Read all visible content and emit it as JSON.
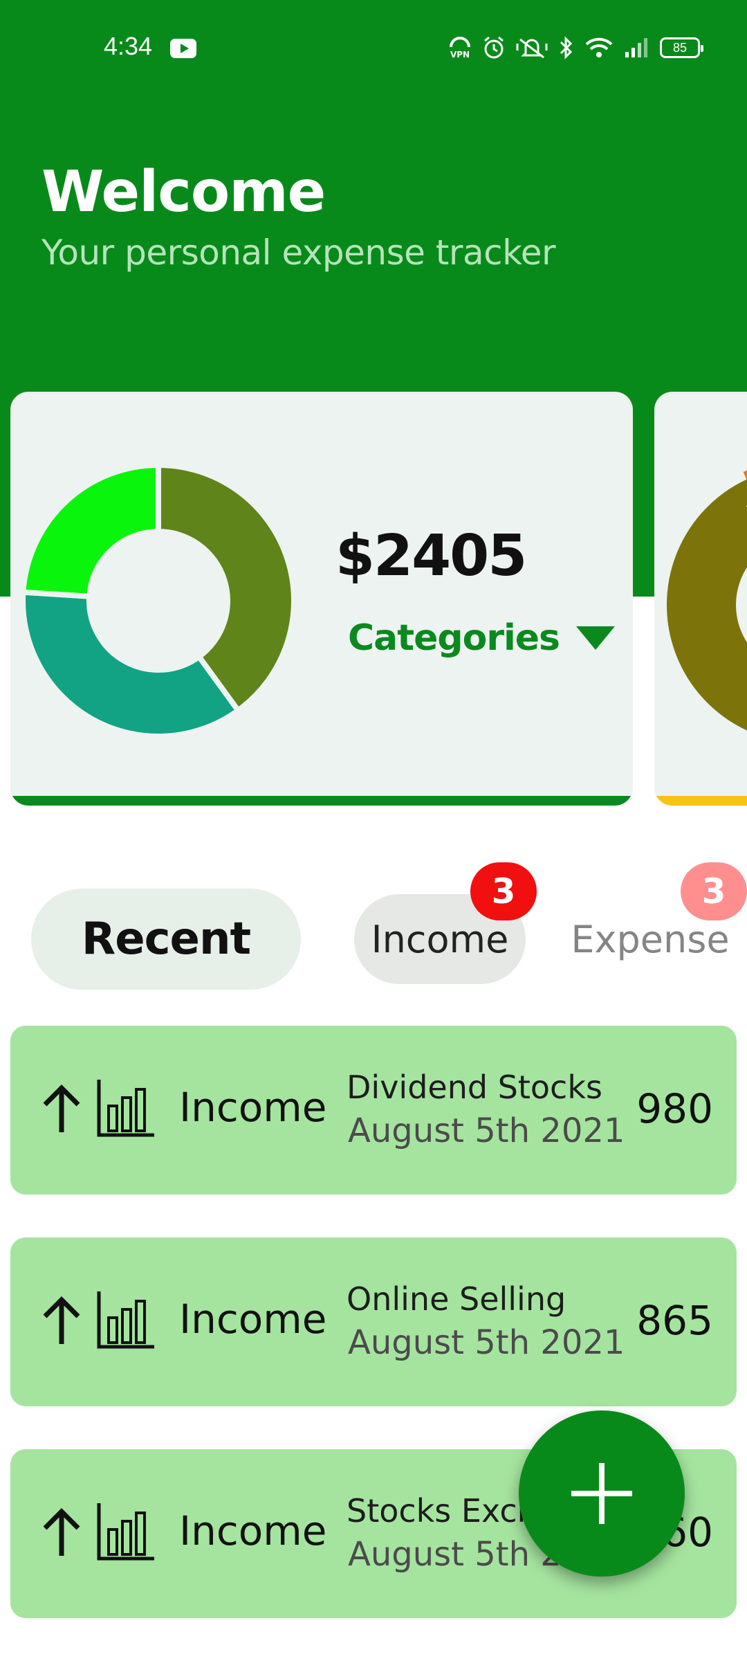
{
  "status_bar": {
    "time": "4:34",
    "battery": "85",
    "icons": [
      "youtube-icon",
      "vpn-icon",
      "alarm-icon",
      "mute-icon",
      "bluetooth-icon",
      "wifi-icon",
      "signal-icon",
      "battery-icon"
    ]
  },
  "header": {
    "title": "Welcome",
    "subtitle": "Your personal expense tracker",
    "background_color": "#088a1b"
  },
  "summary_card": {
    "total": "$2405",
    "category_selector": "Categories",
    "strip_color": "#0a8a1e",
    "donut_segments": [
      {
        "color": "#5f8419",
        "fraction": 0.4
      },
      {
        "color": "#11a384",
        "fraction": 0.36
      },
      {
        "color": "#0af50c",
        "fraction": 0.24
      }
    ]
  },
  "next_card": {
    "strip_color": "#f5c414",
    "segment_colors": [
      "#7c740a",
      "#e07b1f"
    ]
  },
  "tabs": {
    "recent": "Recent",
    "income": "Income",
    "income_badge": "3",
    "expense": "Expense",
    "expense_badge": "3"
  },
  "transactions": [
    {
      "type": "Income",
      "title": "Dividend Stocks",
      "date": "August 5th 2021",
      "amount": "980"
    },
    {
      "type": "Income",
      "title": "Online Selling",
      "date": "August 5th 2021",
      "amount": "865"
    },
    {
      "type": "Income",
      "title": "Stocks Exchange",
      "date": "August 5th 2021",
      "amount": "560"
    }
  ],
  "fab": {
    "icon": "plus-icon",
    "color": "#088a1b"
  }
}
